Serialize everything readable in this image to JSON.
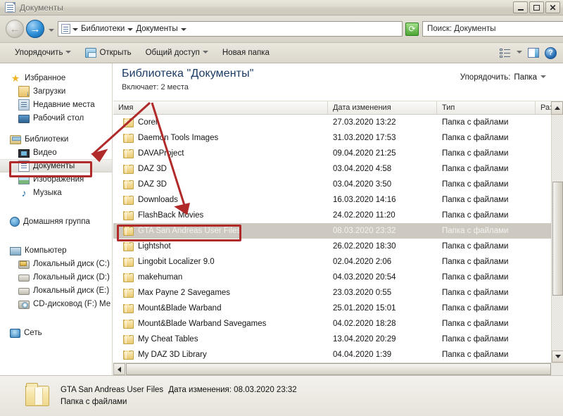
{
  "window": {
    "title": "Документы",
    "title_icon": "document-library-icon",
    "minimize_label": "_",
    "maximize_label": "□",
    "close_label": "✕"
  },
  "address_bar": {
    "back_label": "←",
    "forward_label": "→",
    "history_dropdown": "▾",
    "crumb_icon": "documents-icon",
    "breadcrumbs": [
      "Библиотеки",
      "Документы"
    ],
    "refresh_icon": "refresh-icon",
    "search_value": "Поиск: Документы",
    "search_icon": "magnifier-icon"
  },
  "command_bar": {
    "organize": "Упорядочить",
    "open": "Открыть",
    "share": "Общий доступ",
    "new_folder": "Новая папка",
    "view_icon": "list-view-icon",
    "view_dropdown": "▾",
    "preview_pane_icon": "preview-pane-icon",
    "help_icon": "help-icon"
  },
  "sidebar": {
    "groups": [
      {
        "header": {
          "label": "Избранное",
          "icon": "star-icon"
        },
        "items": [
          {
            "label": "Загрузки",
            "icon": "downloads-icon"
          },
          {
            "label": "Недавние места",
            "icon": "recent-places-icon"
          },
          {
            "label": "Рабочий стол",
            "icon": "desktop-icon"
          }
        ]
      },
      {
        "header": {
          "label": "Библиотеки",
          "icon": "libraries-icon"
        },
        "items": [
          {
            "label": "Видео",
            "icon": "video-icon"
          },
          {
            "label": "Документы",
            "icon": "documents-icon",
            "selected": true
          },
          {
            "label": "Изображения",
            "icon": "pictures-icon"
          },
          {
            "label": "Музыка",
            "icon": "music-icon"
          }
        ]
      },
      {
        "header": {
          "label": "Домашняя группа",
          "icon": "homegroup-icon"
        },
        "items": []
      },
      {
        "header": {
          "label": "Компьютер",
          "icon": "computer-icon"
        },
        "items": [
          {
            "label": "Локальный диск (C:)",
            "icon": "system-drive-icon"
          },
          {
            "label": "Локальный диск (D:)",
            "icon": "drive-icon"
          },
          {
            "label": "Локальный диск (E:)",
            "icon": "drive-icon"
          },
          {
            "label": "CD-дисковод (F:) Ме",
            "icon": "cd-drive-icon"
          }
        ]
      },
      {
        "header": {
          "label": "Сеть",
          "icon": "network-icon"
        },
        "items": []
      }
    ]
  },
  "library_header": {
    "title": "Библиотека \"Документы\"",
    "includes_label": "Включает:",
    "includes_value": "2 места",
    "arrange_label": "Упорядочить:",
    "arrange_value": "Папка",
    "arrange_dropdown": "▾"
  },
  "columns": [
    {
      "key": "name",
      "label": "Имя"
    },
    {
      "key": "date",
      "label": "Дата изменения"
    },
    {
      "key": "type",
      "label": "Тип"
    },
    {
      "key": "size",
      "label": "Ра:"
    }
  ],
  "rows": [
    {
      "name": "Corel",
      "date": "27.03.2020 13:22",
      "type": "Папка с файлами",
      "selected": false
    },
    {
      "name": "Daemon Tools Images",
      "date": "31.03.2020 17:53",
      "type": "Папка с файлами",
      "selected": false
    },
    {
      "name": "DAVAProject",
      "date": "09.04.2020 21:25",
      "type": "Папка с файлами",
      "selected": false
    },
    {
      "name": "DAZ 3D",
      "date": "03.04.2020 4:58",
      "type": "Папка с файлами",
      "selected": false
    },
    {
      "name": "DAZ 3D",
      "date": "03.04.2020 3:50",
      "type": "Папка с файлами",
      "selected": false
    },
    {
      "name": "Downloads",
      "date": "16.03.2020 14:16",
      "type": "Папка с файлами",
      "selected": false
    },
    {
      "name": "FlashBack Movies",
      "date": "24.02.2020 11:20",
      "type": "Папка с файлами",
      "selected": false
    },
    {
      "name": "GTA San Andreas User Files",
      "date": "08.03.2020 23:32",
      "type": "Папка с файлами",
      "selected": true
    },
    {
      "name": "Lightshot",
      "date": "26.02.2020 18:30",
      "type": "Папка с файлами",
      "selected": false
    },
    {
      "name": "Lingobit Localizer 9.0",
      "date": "02.04.2020 2:06",
      "type": "Папка с файлами",
      "selected": false
    },
    {
      "name": "makehuman",
      "date": "04.03.2020 20:54",
      "type": "Папка с файлами",
      "selected": false
    },
    {
      "name": "Max Payne 2 Savegames",
      "date": "23.03.2020 0:55",
      "type": "Папка с файлами",
      "selected": false
    },
    {
      "name": "Mount&Blade Warband",
      "date": "25.01.2020 15:01",
      "type": "Папка с файлами",
      "selected": false
    },
    {
      "name": "Mount&Blade Warband Savegames",
      "date": "04.02.2020 18:28",
      "type": "Папка с файлами",
      "selected": false
    },
    {
      "name": "My Cheat Tables",
      "date": "13.04.2020 20:29",
      "type": "Папка с файлами",
      "selected": false
    },
    {
      "name": "My DAZ 3D Library",
      "date": "04.04.2020 1:39",
      "type": "Папка с файлами",
      "selected": false
    }
  ],
  "details_pane": {
    "icon": "folder-icon",
    "name": "GTA San Andreas User Files",
    "date_label": "Дата изменения:",
    "date_value": "08.03.2020 23:32",
    "type": "Папка с файлами"
  },
  "annotations": {
    "accent_color": "#b02a2a",
    "highlight_sidebar_item": "Документы",
    "highlight_row": "GTA San Andreas User Files",
    "arrows": 2
  }
}
